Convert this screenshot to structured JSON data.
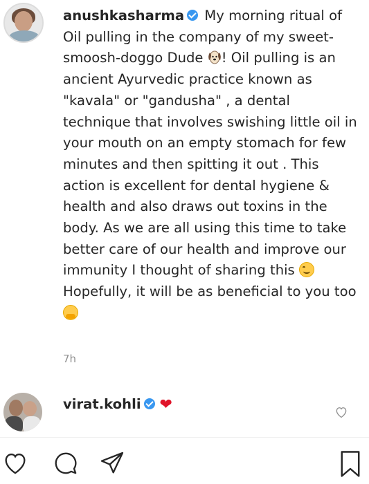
{
  "post": {
    "author": "anushkasharma",
    "caption_part1": " My morning ritual of Oil pulling in the company of my sweet-smoosh-doggo Dude ",
    "caption_part2": "! Oil pulling is an ancient Ayurvedic practice known as \"kavala\" or \"gandusha\" , a dental technique that involves swishing little oil in your mouth on an empty stomach for few minutes and then spitting it out . This action is excellent for dental hygiene & health and also draws out toxins in the body. As we are all using this time to take better care of our health and improve our immunity I thought of sharing this ",
    "caption_part3": " Hopefully, it will be as beneficial to you too",
    "time": "7h"
  },
  "comment": {
    "author": "virat.kohli",
    "text": "❤"
  },
  "icons": {
    "verified": "verified-badge-icon",
    "like": "heart-icon",
    "comment": "speech-bubble-icon",
    "share": "paper-plane-icon",
    "save": "bookmark-icon"
  },
  "colors": {
    "verified": "#3897f0",
    "heart": "#e0142a",
    "muted": "#8e8e8e"
  }
}
